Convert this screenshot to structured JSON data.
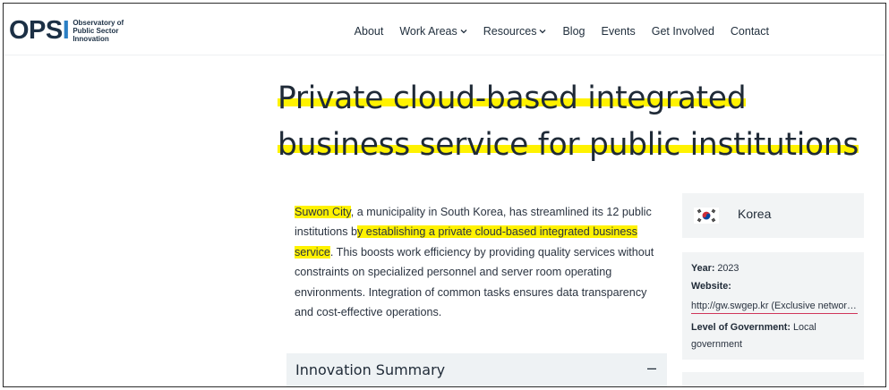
{
  "logo": {
    "mark_op": "OPS",
    "mark_i": "I",
    "text_line1": "Observatory of",
    "text_line2": "Public Sector",
    "text_line3": "Innovation"
  },
  "nav": {
    "items": [
      {
        "label": "About",
        "dropdown": false
      },
      {
        "label": "Work Areas",
        "dropdown": true
      },
      {
        "label": "Resources",
        "dropdown": true
      },
      {
        "label": "Blog",
        "dropdown": false
      },
      {
        "label": "Events",
        "dropdown": false
      },
      {
        "label": "Get Involved",
        "dropdown": false
      },
      {
        "label": "Contact",
        "dropdown": false
      }
    ]
  },
  "title": {
    "line1": "Private cloud-based integrated",
    "line2": "business service for public institutions"
  },
  "description": {
    "p1_hl": "Suwon City",
    "p1_a": ", a municipality in South Korea, has streamlined its 12 public institutions b",
    "p1_hl2": "y establishing a private cloud-based integrated business service",
    "p1_b": ". This boosts work efficiency by providing quality services without constraints on specialized personnel and server room operating environments. Integration of common tasks ensures data transparency and cost-effective operations."
  },
  "summary": {
    "label": "Innovation Summary",
    "toggle": "–"
  },
  "sidebar": {
    "country": "Korea",
    "year_label": "Year:",
    "year_value": "2023",
    "website_label": "Website:",
    "website_value": "http://gw.swgep.kr (Exclusive network access only)",
    "level_label": "Level of Government:",
    "level_value": "Local government"
  },
  "colors": {
    "highlight": "#fff200",
    "navy": "#1c3045",
    "accent_blue": "#2b7fc4",
    "panel_bg": "#f2f4f5",
    "link_underline": "#d0355a"
  }
}
